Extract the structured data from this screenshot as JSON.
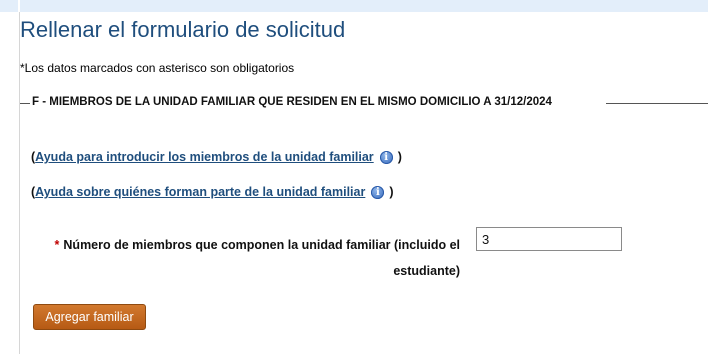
{
  "page": {
    "title": "Rellenar el formulario de solicitud",
    "required_note": "*Los datos marcados con asterisco son obligatorios"
  },
  "section": {
    "legend": "F - MIEMBROS DE LA UNIDAD FAMILIAR QUE RESIDEN EN EL MISMO DOMICILIO A 31/12/2024",
    "help_links": [
      {
        "open": "(",
        "label": "Ayuda para introducir los miembros de la unidad familiar",
        "icon": "info-icon",
        "close": ")"
      },
      {
        "open": "(",
        "label": "Ayuda sobre quiénes forman parte de la unidad familiar",
        "icon": "info-icon",
        "close": ")"
      }
    ],
    "members_field": {
      "required_mark": "*",
      "label": "Número de miembros que componen la unidad familiar (incluido el estudiante)",
      "value": "3"
    },
    "add_button_label": "Agregar familiar"
  },
  "colors": {
    "title": "#1f4e7d",
    "link": "#1f4e7d",
    "required": "#c00000",
    "button": "#c46a22",
    "top_band": "#e3eefa"
  }
}
